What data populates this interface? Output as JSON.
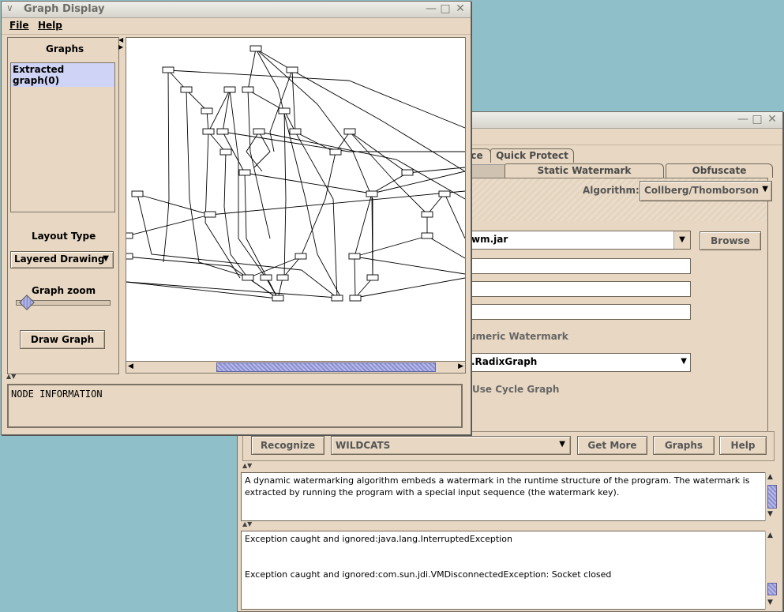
{
  "graph_window": {
    "title": "Graph Display",
    "menu": [
      "File",
      "Help"
    ],
    "graphs_header": "Graphs",
    "graphs_list": [
      "Extracted graph(0)"
    ],
    "layout_type_label": "Layout Type",
    "layout_type_value": "Layered Drawing",
    "graph_zoom_label": "Graph zoom",
    "draw_graph_button": "Draw Graph",
    "node_info_text": "NODE INFORMATION"
  },
  "main_window": {
    "tabs_row1": [
      "ce",
      "Quick Protect"
    ],
    "tabs_row2": [
      "Static Watermark",
      "Obfuscate"
    ],
    "algorithm_label": "Algorithm:",
    "algorithm_value": "Collberg/Thomborson",
    "browse_button": "Browse",
    "jar_field_value": "wm.jar",
    "numeric_watermark_label": "umeric Watermark",
    "graph_class_value": ".RadixGraph",
    "use_cycle_graph_label": "Use Cycle Graph",
    "recognize_button": "Recognize",
    "watermark_combo_value": "WILDCATS",
    "get_more_button": "Get More",
    "graphs_button": "Graphs",
    "help_button": "Help",
    "description_text": "A dynamic watermarking algorithm embeds a watermark in the runtime structure of the program. The watermark is extracted by running the program with a special input sequence (the watermark key).",
    "log_line1": "Exception caught and ignored:java.lang.InterruptedException",
    "log_line2": "Exception caught and ignored:com.sun.jdi.VMDisconnectedException: Socket closed"
  },
  "colors": {
    "desktop": "#8fbfc9",
    "panel": "#e8d8c3",
    "selection": "#cfd3f5"
  },
  "icons": [
    "window-menu-icon",
    "minimize-icon",
    "maximize-icon",
    "close-icon",
    "dropdown-arrow-icon",
    "scroll-left-icon",
    "scroll-right-icon",
    "scroll-up-icon",
    "scroll-down-icon"
  ]
}
